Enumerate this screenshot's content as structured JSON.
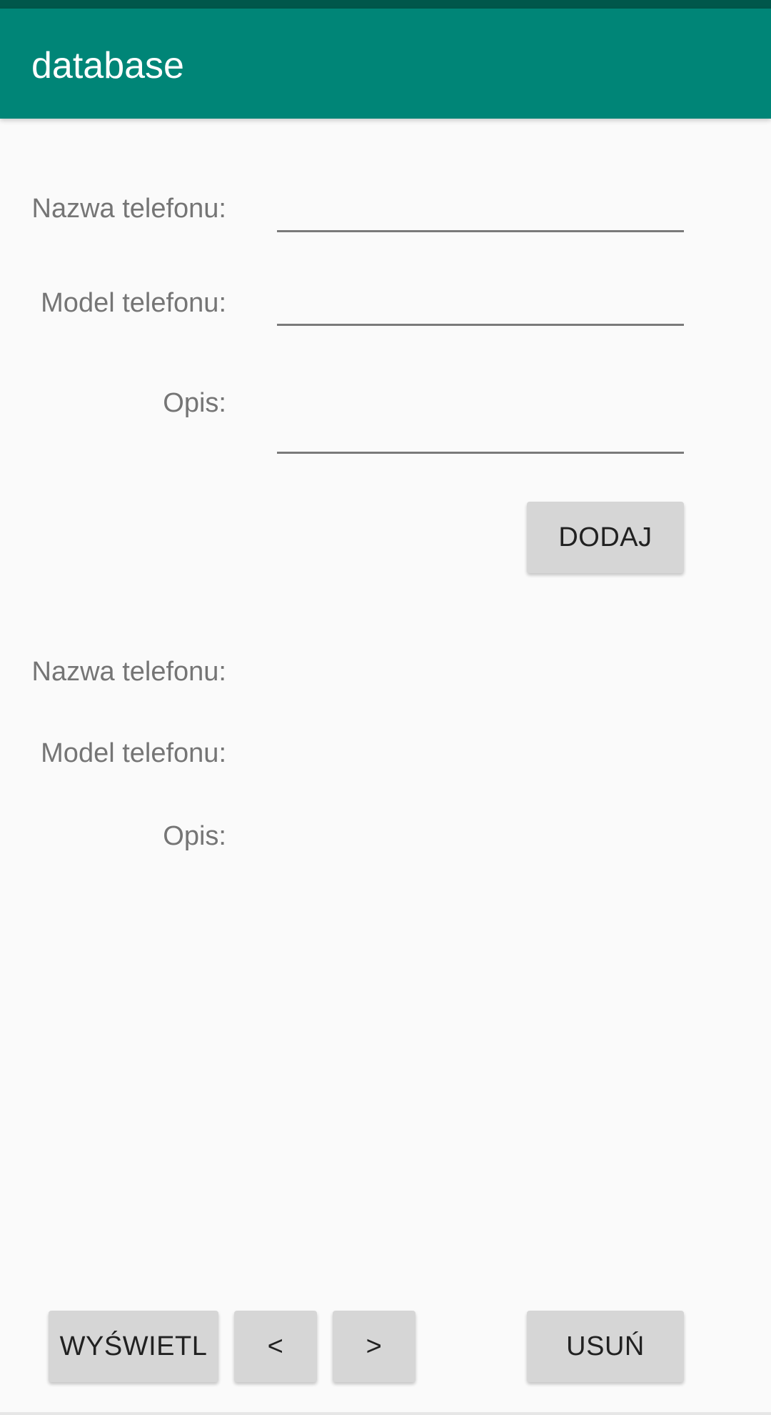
{
  "app_bar": {
    "title": "database",
    "color": "#008577",
    "status_bar_color": "#00574b"
  },
  "form": {
    "name_label": "Nazwa telefonu:",
    "model_label": "Model telefonu:",
    "desc_label": "Opis:",
    "name_value": "",
    "model_value": "",
    "desc_value": "",
    "add_button": "DODAJ"
  },
  "display": {
    "name_label": "Nazwa telefonu:",
    "model_label": "Model telefonu:",
    "desc_label": "Opis:"
  },
  "bottom_bar": {
    "show_button": "WYŚWIETL",
    "prev_button": "<",
    "next_button": ">",
    "delete_button": "USUŃ"
  }
}
